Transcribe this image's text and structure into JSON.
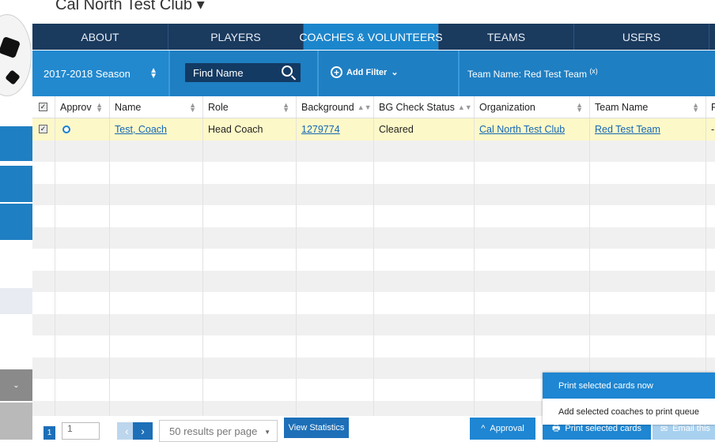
{
  "club": {
    "title": "Cal North Test Club"
  },
  "tabs": [
    {
      "label": "ABOUT"
    },
    {
      "label": "PLAYERS"
    },
    {
      "label": "COACHES & VOLUNTEERS"
    },
    {
      "label": "TEAMS"
    },
    {
      "label": "USERS"
    }
  ],
  "filters": {
    "season": "2017-2018 Season",
    "find_placeholder": "Find Name",
    "add_filter": "Add Filter",
    "team_chip": "Team Name: Red Test Team",
    "team_chip_remove": "(x)"
  },
  "table": {
    "headers": [
      "Approv",
      "Name",
      "Role",
      "Background",
      "BG Check Status",
      "Organization",
      "Team Name",
      "F"
    ],
    "rows": [
      {
        "name": "Test, Coach",
        "role": "Head Coach",
        "background": "1279774",
        "bg_status": "Cleared",
        "organization": "Cal North Test Club",
        "team": "Red Test Team",
        "extra": "-"
      }
    ]
  },
  "footer": {
    "page": "1",
    "page_input": "1",
    "per_page": "50 results per page",
    "view_statistics": "View Statistics",
    "approval": "Approval",
    "print_cards": "Print selected cards",
    "email": "Email this"
  },
  "print_menu": {
    "item1": "Print selected cards now",
    "item2": "Add selected coaches to print queue"
  },
  "colors": {
    "tab_bar": "#1a3a5e",
    "accent": "#1f7fc3",
    "selected_row": "#fdf8c8",
    "link": "#1467b3"
  }
}
